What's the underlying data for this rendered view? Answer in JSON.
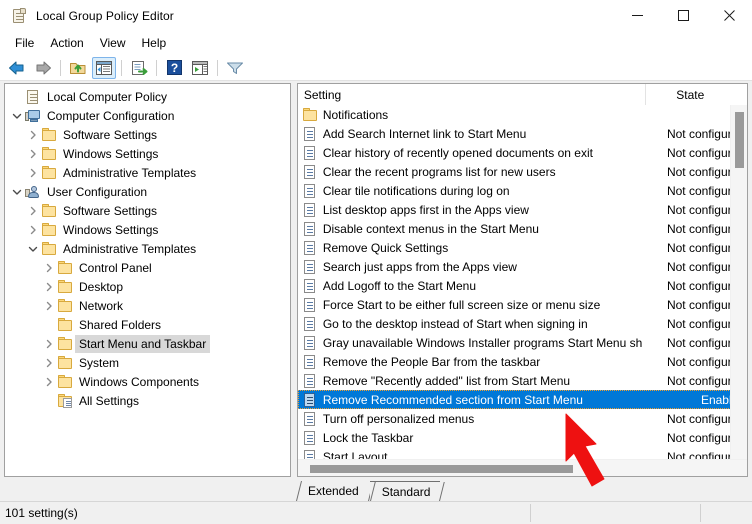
{
  "window": {
    "title": "Local Group Policy Editor",
    "icon": "policy-scroll-icon",
    "minimize_label": "—",
    "maximize_label": "□",
    "close_label": "✕"
  },
  "menubar": {
    "items": [
      {
        "label": "File"
      },
      {
        "label": "Action"
      },
      {
        "label": "View"
      },
      {
        "label": "Help"
      }
    ]
  },
  "toolbar": {
    "buttons": [
      {
        "name": "back-button",
        "icon": "left-arrow-icon"
      },
      {
        "name": "forward-button",
        "icon": "right-arrow-icon"
      },
      {
        "name": "up-one-level-button",
        "icon": "folder-up-icon"
      },
      {
        "name": "show-hide-console-tree-button",
        "icon": "console-tree-icon",
        "pressed": true
      },
      {
        "name": "export-list-button",
        "icon": "export-list-icon"
      },
      {
        "name": "help-button",
        "icon": "question-mark-icon"
      },
      {
        "name": "show-hide-action-pane-button",
        "icon": "action-pane-icon"
      },
      {
        "name": "filter-button",
        "icon": "funnel-icon"
      }
    ]
  },
  "tree": {
    "nodes": [
      {
        "label": "Local Computer Policy",
        "depth": 0,
        "twist": "",
        "icon": "scroll",
        "selected": false
      },
      {
        "label": "Computer Configuration",
        "depth": 0,
        "twist": "expanded",
        "icon": "computer",
        "selected": false
      },
      {
        "label": "Software Settings",
        "depth": 1,
        "twist": "collapsed",
        "icon": "folder",
        "selected": false
      },
      {
        "label": "Windows Settings",
        "depth": 1,
        "twist": "collapsed",
        "icon": "folder",
        "selected": false
      },
      {
        "label": "Administrative Templates",
        "depth": 1,
        "twist": "collapsed",
        "icon": "folder",
        "selected": false
      },
      {
        "label": "User Configuration",
        "depth": 0,
        "twist": "expanded",
        "icon": "user",
        "selected": false
      },
      {
        "label": "Software Settings",
        "depth": 1,
        "twist": "collapsed",
        "icon": "folder",
        "selected": false
      },
      {
        "label": "Windows Settings",
        "depth": 1,
        "twist": "collapsed",
        "icon": "folder",
        "selected": false
      },
      {
        "label": "Administrative Templates",
        "depth": 1,
        "twist": "expanded",
        "icon": "folder",
        "selected": false
      },
      {
        "label": "Control Panel",
        "depth": 2,
        "twist": "collapsed",
        "icon": "folder",
        "selected": false
      },
      {
        "label": "Desktop",
        "depth": 2,
        "twist": "collapsed",
        "icon": "folder",
        "selected": false
      },
      {
        "label": "Network",
        "depth": 2,
        "twist": "collapsed",
        "icon": "folder",
        "selected": false
      },
      {
        "label": "Shared Folders",
        "depth": 2,
        "twist": "",
        "icon": "folder",
        "selected": false
      },
      {
        "label": "Start Menu and Taskbar",
        "depth": 2,
        "twist": "collapsed",
        "icon": "folder",
        "selected": true
      },
      {
        "label": "System",
        "depth": 2,
        "twist": "collapsed",
        "icon": "folder",
        "selected": false
      },
      {
        "label": "Windows Components",
        "depth": 2,
        "twist": "collapsed",
        "icon": "folder",
        "selected": false
      },
      {
        "label": "All Settings",
        "depth": 2,
        "twist": "",
        "icon": "all-settings",
        "selected": false
      }
    ]
  },
  "list": {
    "columns": [
      {
        "label": "Setting",
        "key": "setting"
      },
      {
        "label": "State",
        "key": "state"
      }
    ],
    "rows": [
      {
        "setting": "Notifications",
        "state": "",
        "icon": "folder",
        "selected": false
      },
      {
        "setting": "Add Search Internet link to Start Menu",
        "state": "Not configured",
        "icon": "policy",
        "selected": false
      },
      {
        "setting": "Clear history of recently opened documents on exit",
        "state": "Not configured",
        "icon": "policy",
        "selected": false
      },
      {
        "setting": "Clear the recent programs list for new users",
        "state": "Not configured",
        "icon": "policy",
        "selected": false
      },
      {
        "setting": "Clear tile notifications during log on",
        "state": "Not configured",
        "icon": "policy",
        "selected": false
      },
      {
        "setting": "List desktop apps first in the Apps view",
        "state": "Not configured",
        "icon": "policy",
        "selected": false
      },
      {
        "setting": "Disable context menus in the Start Menu",
        "state": "Not configured",
        "icon": "policy",
        "selected": false
      },
      {
        "setting": "Remove Quick Settings",
        "state": "Not configured",
        "icon": "policy",
        "selected": false
      },
      {
        "setting": "Search just apps from the Apps view",
        "state": "Not configured",
        "icon": "policy",
        "selected": false
      },
      {
        "setting": "Add Logoff to the Start Menu",
        "state": "Not configured",
        "icon": "policy",
        "selected": false
      },
      {
        "setting": "Force Start to be either full screen size or menu size",
        "state": "Not configured",
        "icon": "policy",
        "selected": false
      },
      {
        "setting": "Go to the desktop instead of Start when signing in",
        "state": "Not configured",
        "icon": "policy",
        "selected": false
      },
      {
        "setting": "Gray unavailable Windows Installer programs Start Menu sh...",
        "state": "Not configured",
        "icon": "policy",
        "selected": false
      },
      {
        "setting": "Remove the People Bar from the taskbar",
        "state": "Not configured",
        "icon": "policy",
        "selected": false
      },
      {
        "setting": "Remove \"Recently added\" list from Start Menu",
        "state": "Not configured",
        "icon": "policy",
        "selected": false
      },
      {
        "setting": "Remove Recommended section from Start Menu",
        "state": "Enabled",
        "icon": "policy",
        "selected": true
      },
      {
        "setting": "Turn off personalized menus",
        "state": "Not configured",
        "icon": "policy",
        "selected": false
      },
      {
        "setting": "Lock the Taskbar",
        "state": "Not configured",
        "icon": "policy",
        "selected": false
      },
      {
        "setting": "Start Layout",
        "state": "Not configured",
        "icon": "policy",
        "selected": false
      }
    ]
  },
  "tabs": [
    {
      "label": "Extended",
      "active": false
    },
    {
      "label": "Standard",
      "active": true
    }
  ],
  "statusbar": {
    "text": "101 setting(s)"
  },
  "annotation": {
    "type": "red-arrow",
    "color": "#ee1111",
    "points_to": "Remove Recommended section from Start Menu"
  },
  "colors": {
    "selection_blue": "#0078d7",
    "tree_selection_gray": "#d8d8d8",
    "window_bg": "#f0f0f0",
    "pane_bg": "#ffffff",
    "annotation_red": "#ee1111"
  }
}
